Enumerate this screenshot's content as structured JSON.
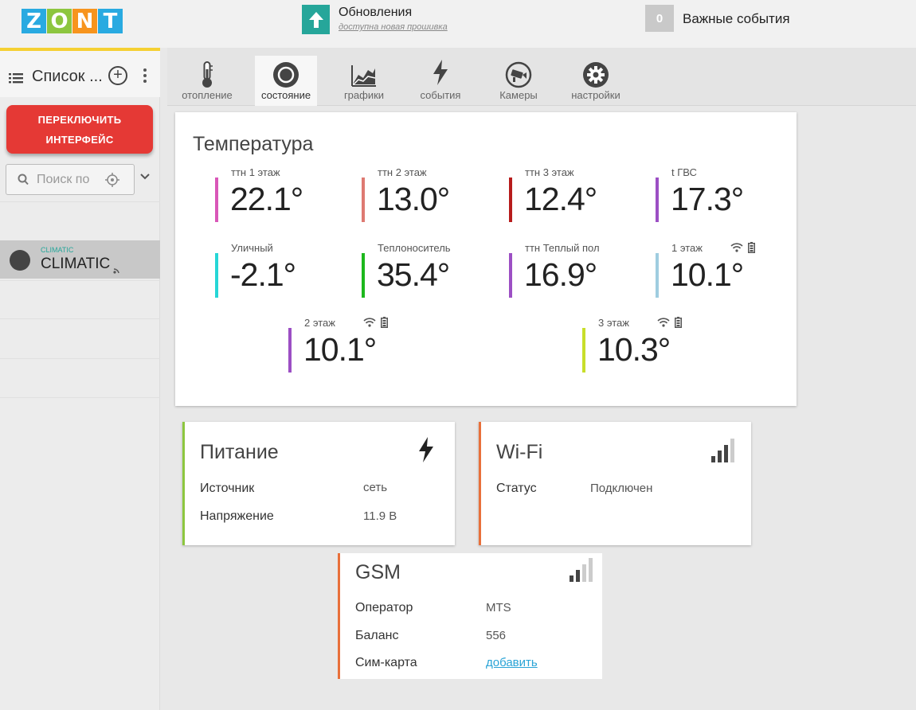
{
  "logo": {
    "letters": [
      "Z",
      "O",
      "N",
      "T"
    ],
    "colors": [
      "#29aae1",
      "#8dc63f",
      "#f7941d",
      "#29aae1"
    ]
  },
  "header": {
    "update_title": "Обновления",
    "update_subtitle": "доступна новая прошивка",
    "events_count": "0",
    "events_label": "Важные события"
  },
  "sidebar": {
    "list_title": "Список ...",
    "switch_button": [
      "ПЕРЕКЛЮЧИТЬ",
      "ИНТЕРФЕЙС"
    ],
    "search_placeholder": "Поиск по",
    "device": {
      "small_label": "CLIMATIC",
      "name": "CLIMATIC"
    }
  },
  "tabs": [
    {
      "label": "отопление",
      "icon": "thermometer-icon"
    },
    {
      "label": "состояние",
      "icon": "circle-icon",
      "active": true
    },
    {
      "label": "графики",
      "icon": "chart-icon"
    },
    {
      "label": "события",
      "icon": "lightning-icon"
    },
    {
      "label": "Камеры",
      "icon": "camera-icon"
    },
    {
      "label": "настройки",
      "icon": "gear-icon"
    }
  ],
  "temperature": {
    "title": "Температура",
    "sensors": [
      {
        "label": "ттн 1 этаж",
        "value": "22.1°",
        "color": "#d957b8"
      },
      {
        "label": "ттн 2 этаж",
        "value": "13.0°",
        "color": "#de7a72"
      },
      {
        "label": "ттн 3 этаж",
        "value": "12.4°",
        "color": "#b71c1c"
      },
      {
        "label": "t ГВС",
        "value": "17.3°",
        "color": "#9c4fc4"
      },
      {
        "label": "Уличный",
        "value": "-2.1°",
        "color": "#26d6d6"
      },
      {
        "label": "Теплоноситель",
        "value": "35.4°",
        "color": "#1db81d"
      },
      {
        "label": "ттн Теплый пол",
        "value": "16.9°",
        "color": "#9c4fc4"
      },
      {
        "label": "1 этаж",
        "value": "10.1°",
        "color": "#9fcde0",
        "wireless": true
      },
      {
        "label": "2 этаж",
        "value": "10.1°",
        "color": "#9c4fc4",
        "wireless": true
      },
      {
        "label": "3 этаж",
        "value": "10.3°",
        "color": "#c8de2a",
        "wireless": true
      }
    ]
  },
  "power": {
    "title": "Питание",
    "accent": "#8dc63f",
    "rows": [
      [
        "Источник",
        "сеть"
      ],
      [
        "Напряжение",
        "11.9 В"
      ]
    ]
  },
  "wifi": {
    "title": "Wi-Fi",
    "accent": "#e8703a",
    "rows": [
      [
        "Статус",
        "Подключен"
      ]
    ]
  },
  "gsm": {
    "title": "GSM",
    "accent": "#e8703a",
    "rows": [
      [
        "Оператор",
        "MTS"
      ],
      [
        "Баланс",
        "556"
      ],
      [
        "Сим-карта",
        "добавить"
      ]
    ]
  }
}
